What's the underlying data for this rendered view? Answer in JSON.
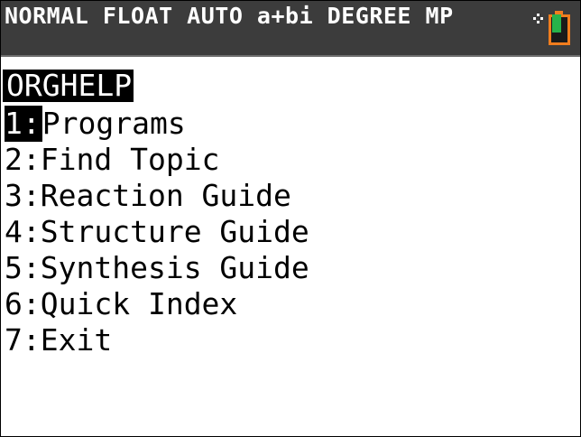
{
  "status_bar": {
    "text": "NORMAL FLOAT AUTO a+bi DEGREE MP",
    "battery_color": "#f07d1e",
    "battery_fill_color": "#27b34a",
    "busy_icon": "busy-indicator-icon",
    "battery_icon": "battery-icon"
  },
  "menu": {
    "title": "ORGHELP",
    "items": [
      {
        "key": "1:",
        "label": "Programs",
        "selected": true
      },
      {
        "key": "2:",
        "label": "Find Topic",
        "selected": false
      },
      {
        "key": "3:",
        "label": "Reaction Guide",
        "selected": false
      },
      {
        "key": "4:",
        "label": "Structure Guide",
        "selected": false
      },
      {
        "key": "5:",
        "label": "Synthesis Guide",
        "selected": false
      },
      {
        "key": "6:",
        "label": "Quick Index",
        "selected": false
      },
      {
        "key": "7:",
        "label": "Exit",
        "selected": false
      }
    ]
  }
}
